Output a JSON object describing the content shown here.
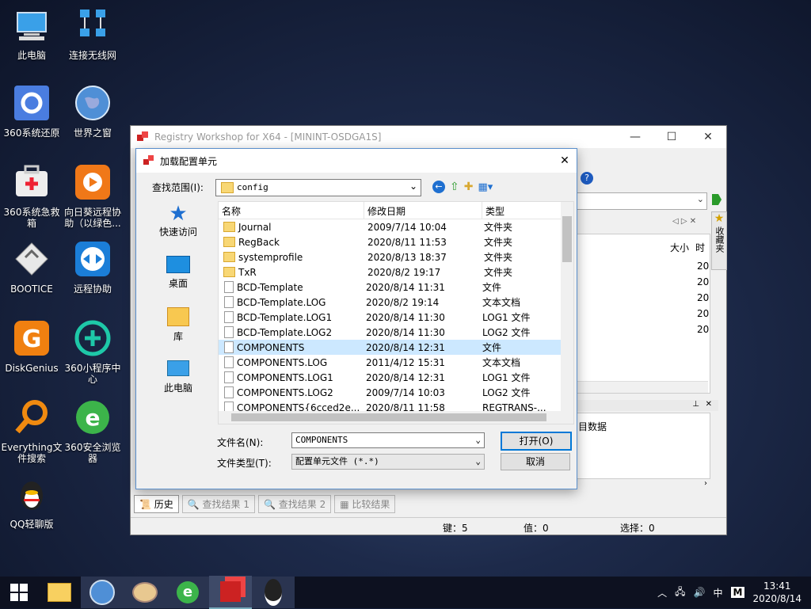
{
  "desktop": {
    "icons": [
      {
        "label": "此电脑"
      },
      {
        "label": "连接无线网"
      },
      {
        "label": "360系统还原"
      },
      {
        "label": "世界之窗"
      },
      {
        "label": "360系统急救箱"
      },
      {
        "label": "向日葵远程协助（以绿色..."
      },
      {
        "label": "BOOTICE"
      },
      {
        "label": "远程协助"
      },
      {
        "label": "DiskGenius"
      },
      {
        "label": "360小程序中心"
      },
      {
        "label": "Everything文件搜索"
      },
      {
        "label": "360安全浏览器"
      },
      {
        "label": "QQ轻聊版"
      }
    ]
  },
  "app": {
    "title": "Registry Workshop for X64 - [MININT-OSDGA1S]",
    "controls": {
      "minimize": "—",
      "maximize": "☐",
      "close": "✕"
    },
    "favorites_tab": "收藏夹",
    "list_headers": {
      "size": "大小",
      "time": "时"
    },
    "time_values": [
      "20",
      "20",
      "20",
      "20",
      "20"
    ],
    "panel_text": "目数据",
    "bottom_tabs": [
      "历史",
      "查找结果 1",
      "查找结果 2",
      "比较结果"
    ],
    "status": {
      "keys": "键：5",
      "values": "值：0",
      "selection": "选择：0"
    }
  },
  "dialog": {
    "title": "加载配置单元",
    "close": "✕",
    "lookin_label": "查找范围(I):",
    "lookin_value": "config",
    "places": [
      "快速访问",
      "桌面",
      "库",
      "此电脑"
    ],
    "headers": {
      "name": "名称",
      "date": "修改日期",
      "type": "类型"
    },
    "files": [
      {
        "name": "Journal",
        "date": "2009/7/14 10:04",
        "type": "文件夹",
        "folder": true
      },
      {
        "name": "RegBack",
        "date": "2020/8/11 11:53",
        "type": "文件夹",
        "folder": true
      },
      {
        "name": "systemprofile",
        "date": "2020/8/13 18:37",
        "type": "文件夹",
        "folder": true
      },
      {
        "name": "TxR",
        "date": "2020/8/2 19:17",
        "type": "文件夹",
        "folder": true
      },
      {
        "name": "BCD-Template",
        "date": "2020/8/14 11:31",
        "type": "文件",
        "folder": false
      },
      {
        "name": "BCD-Template.LOG",
        "date": "2020/8/2 19:14",
        "type": "文本文档",
        "folder": false
      },
      {
        "name": "BCD-Template.LOG1",
        "date": "2020/8/14 11:30",
        "type": "LOG1 文件",
        "folder": false
      },
      {
        "name": "BCD-Template.LOG2",
        "date": "2020/8/14 11:30",
        "type": "LOG2 文件",
        "folder": false
      },
      {
        "name": "COMPONENTS",
        "date": "2020/8/14 12:31",
        "type": "文件",
        "folder": false,
        "selected": true
      },
      {
        "name": "COMPONENTS.LOG",
        "date": "2011/4/12 15:31",
        "type": "文本文档",
        "folder": false
      },
      {
        "name": "COMPONENTS.LOG1",
        "date": "2020/8/14 12:31",
        "type": "LOG1 文件",
        "folder": false
      },
      {
        "name": "COMPONENTS.LOG2",
        "date": "2009/7/14 10:03",
        "type": "LOG2 文件",
        "folder": false
      },
      {
        "name": "COMPONENTS{6cced2e...",
        "date": "2020/8/11 11:58",
        "type": "REGTRANS-...",
        "folder": false
      }
    ],
    "filename_label": "文件名(N):",
    "filename_value": "COMPONENTS",
    "filetype_label": "文件类型(T):",
    "filetype_value": "配置单元文件 (*.*)",
    "open_button": "打开(O)",
    "cancel_button": "取消"
  },
  "taskbar": {
    "time": "13:41",
    "date": "2020/8/14",
    "ime": "中",
    "ime_mode": "M",
    "tray_icons": [
      "chevron-up-icon",
      "network-icon",
      "volume-icon"
    ]
  },
  "colors": {
    "selection": "#cce8ff",
    "accent": "#0078d7"
  }
}
